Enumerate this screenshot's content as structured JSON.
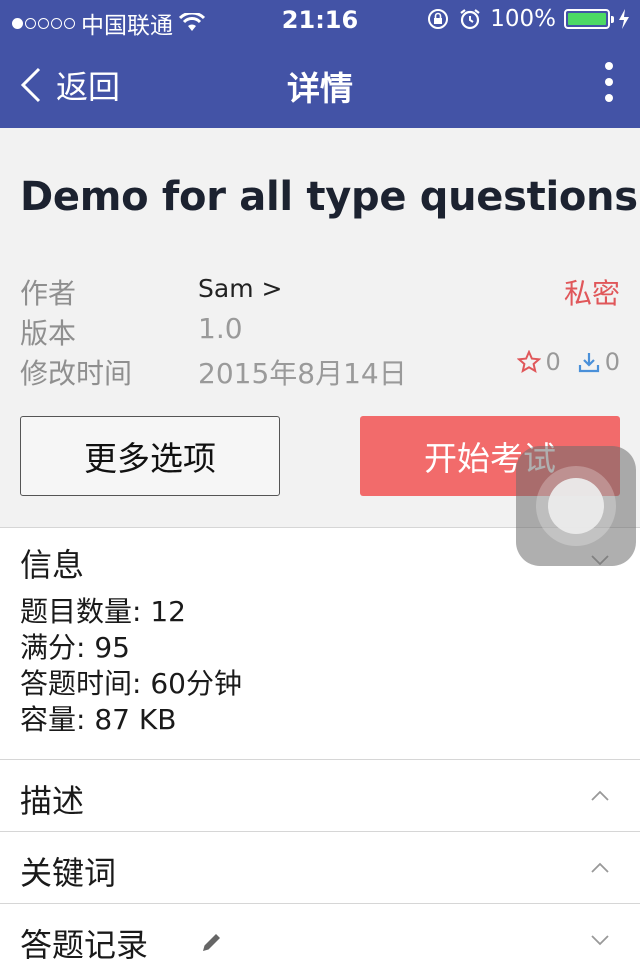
{
  "status_bar": {
    "carrier": "中国联通",
    "time": "21:16",
    "battery": "100%",
    "battery_level": 1.0
  },
  "nav": {
    "back_label": "返回",
    "title": "详情"
  },
  "exam": {
    "title": "Demo for all type questions",
    "author_label": "作者",
    "author_value": "Sam >",
    "version_label": "版本",
    "version_value": "1.0",
    "modified_label": "修改时间",
    "modified_value": "2015年8月14日",
    "privacy": "私密",
    "star_count": "0",
    "download_count": "0",
    "more_options_label": "更多选项",
    "start_exam_label": "开始考试"
  },
  "info": {
    "title": "信息",
    "question_count": "题目数量: 12",
    "full_score": "满分: 95",
    "answer_time": "答题时间: 60分钟",
    "size": "容量: 87 KB"
  },
  "sections": {
    "description": "描述",
    "keywords": "关键词",
    "answer_records": "答题记录"
  },
  "colors": {
    "nav_bg": "#4353a6",
    "accent_red": "#f26b6b",
    "private_red": "#e0575a",
    "star_red": "#e0575a",
    "download_blue": "#4a90d9",
    "battery_green": "#4cd964"
  },
  "icons": [
    "back-chevron-icon",
    "more-vertical-icon",
    "star-icon",
    "download-icon",
    "chevron-down-icon",
    "chevron-up-icon",
    "pencil-icon",
    "wifi-icon",
    "orientation-lock-icon",
    "alarm-icon",
    "battery-icon",
    "charging-icon"
  ]
}
